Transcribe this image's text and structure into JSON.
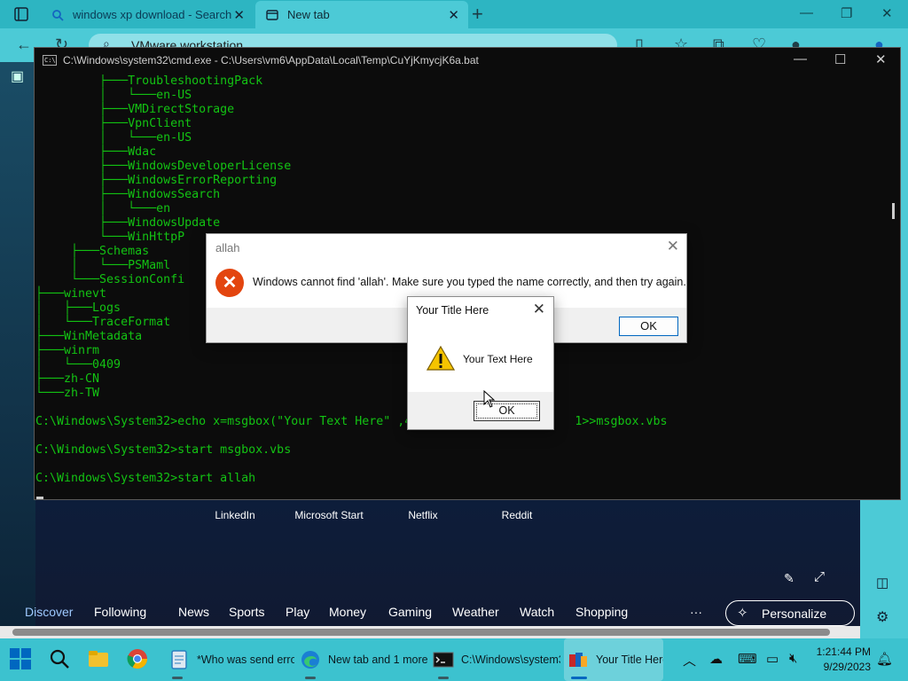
{
  "browser": {
    "tabs": [
      {
        "label": "windows xp download - Search"
      },
      {
        "label": "New tab"
      }
    ],
    "address_text": "VMware workstation"
  },
  "ntp": {
    "quick_links": [
      "LinkedIn",
      "Microsoft Start",
      "Netflix",
      "Reddit"
    ],
    "feed_nav": [
      "Discover",
      "Following",
      "News",
      "Sports",
      "Play",
      "Money",
      "Gaming",
      "Weather",
      "Watch",
      "Shopping"
    ],
    "more": "···",
    "personalize": "Personalize"
  },
  "cmd": {
    "title": "C:\\Windows\\system32\\cmd.exe - C:\\Users\\vm6\\AppData\\Local\\Temp\\CuYjKmycjK6a.bat",
    "lines": [
      "         ├───TroubleshootingPack",
      "         │   └───en-US",
      "         ├───VMDirectStorage",
      "         ├───VpnClient",
      "         │   └───en-US",
      "         ├───Wdac",
      "         ├───WindowsDeveloperLicense",
      "         ├───WindowsErrorReporting",
      "         ├───WindowsSearch",
      "         │   └───en",
      "         ├───WindowsUpdate",
      "         └───WinHttpP",
      "     ├───Schemas",
      "     │   └───PSMaml",
      "     └───SessionConfi",
      "├───winevt",
      "│   ├───Logs",
      "│   └───TraceFormat",
      "├───WinMetadata",
      "├───winrm",
      "│   └───0409",
      "├───zh-CN",
      "└───zh-TW",
      "",
      "C:\\Windows\\System32>echo x=msgbox(\"Your Text Here\" ,4                       1>>msgbox.vbs",
      "",
      "C:\\Windows\\System32>start msgbox.vbs",
      "",
      "C:\\Windows\\System32>start allah"
    ]
  },
  "error_dialog": {
    "title": "allah",
    "message": "Windows cannot find 'allah'. Make sure you typed the name correctly, and then try again.",
    "ok": "OK"
  },
  "msg_dialog": {
    "title": "Your Title Here",
    "text": "Your Text Here",
    "ok": "OK"
  },
  "taskbar": {
    "apps": [
      {
        "label": "*Who was send erro"
      },
      {
        "label": "New tab and 1 more"
      },
      {
        "label": "C:\\Windows\\system32"
      },
      {
        "label": "Your Title Here"
      }
    ],
    "time": "1:21:44 PM",
    "date": "9/29/2023"
  },
  "colors": {
    "browser_frame": "#4ccad6",
    "terminal_text": "#13c313",
    "error_icon": "#e3450f",
    "taskbar": "#3cc2cf"
  }
}
